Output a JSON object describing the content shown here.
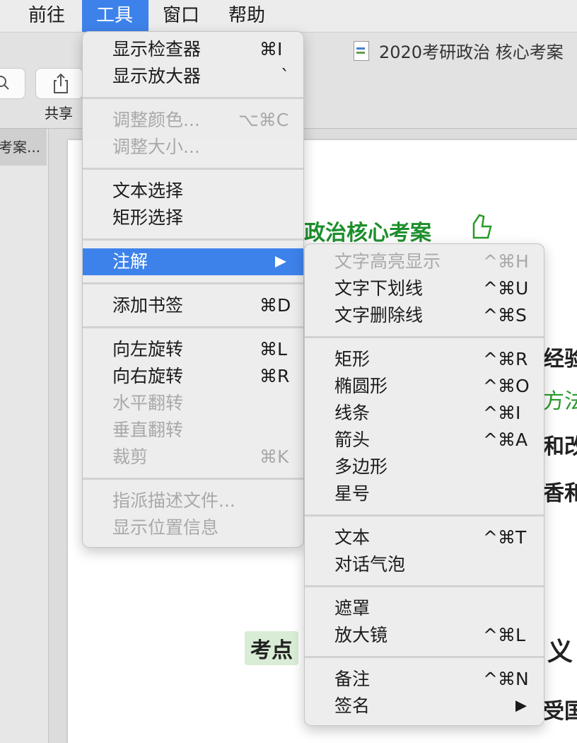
{
  "menubar": {
    "items": [
      {
        "label": "前往"
      },
      {
        "label": "工具"
      },
      {
        "label": "窗口"
      },
      {
        "label": "帮助"
      }
    ]
  },
  "toolbar": {
    "share_label": "共享",
    "document_title": "2020考研政治 核心考案"
  },
  "sidebar": {
    "thumb_label": "考案..."
  },
  "page": {
    "frag1": "政治核心考案",
    "frag2": "经验",
    "frag3": "方法",
    "frag4": "和改",
    "frag5": "香和",
    "frag6": "考点",
    "frag7": "义",
    "frag8": "受国"
  },
  "tools_menu": {
    "items": [
      {
        "label": "显示检查器",
        "shortcut": "⌘I",
        "enabled": true
      },
      {
        "label": "显示放大器",
        "shortcut": "`",
        "enabled": true
      },
      {
        "label": "调整颜色...",
        "shortcut": "⌥⌘C",
        "enabled": false
      },
      {
        "label": "调整大小...",
        "shortcut": "",
        "enabled": false
      },
      {
        "label": "文本选择",
        "shortcut": "",
        "enabled": true
      },
      {
        "label": "矩形选择",
        "shortcut": "",
        "enabled": true
      },
      {
        "label": "注解",
        "shortcut": "",
        "enabled": true,
        "submenu": true
      },
      {
        "label": "添加书签",
        "shortcut": "⌘D",
        "enabled": true
      },
      {
        "label": "向左旋转",
        "shortcut": "⌘L",
        "enabled": true
      },
      {
        "label": "向右旋转",
        "shortcut": "⌘R",
        "enabled": true
      },
      {
        "label": "水平翻转",
        "shortcut": "",
        "enabled": false
      },
      {
        "label": "垂直翻转",
        "shortcut": "",
        "enabled": false
      },
      {
        "label": "裁剪",
        "shortcut": "⌘K",
        "enabled": false
      },
      {
        "label": "指派描述文件...",
        "shortcut": "",
        "enabled": false
      },
      {
        "label": "显示位置信息",
        "shortcut": "",
        "enabled": false
      }
    ]
  },
  "annotate_submenu": {
    "items": [
      {
        "label": "文字高亮显示",
        "shortcut": "^⌘H",
        "enabled": false
      },
      {
        "label": "文字下划线",
        "shortcut": "^⌘U",
        "enabled": true
      },
      {
        "label": "文字删除线",
        "shortcut": "^⌘S",
        "enabled": true
      },
      {
        "label": "矩形",
        "shortcut": "^⌘R",
        "enabled": true
      },
      {
        "label": "椭圆形",
        "shortcut": "^⌘O",
        "enabled": true
      },
      {
        "label": "线条",
        "shortcut": "^⌘I",
        "enabled": true
      },
      {
        "label": "箭头",
        "shortcut": "^⌘A",
        "enabled": true
      },
      {
        "label": "多边形",
        "shortcut": "",
        "enabled": true
      },
      {
        "label": "星号",
        "shortcut": "",
        "enabled": true
      },
      {
        "label": "文本",
        "shortcut": "^⌘T",
        "enabled": true
      },
      {
        "label": "对话气泡",
        "shortcut": "",
        "enabled": true
      },
      {
        "label": "遮罩",
        "shortcut": "",
        "enabled": true
      },
      {
        "label": "放大镜",
        "shortcut": "^⌘L",
        "enabled": true
      },
      {
        "label": "备注",
        "shortcut": "^⌘N",
        "enabled": true
      },
      {
        "label": "签名",
        "shortcut": "",
        "enabled": true,
        "submenu": true
      }
    ]
  },
  "colors": {
    "highlight": "#3d82ea",
    "disabled_text": "#a9a9a9",
    "page_green": "#1d8f2c"
  }
}
